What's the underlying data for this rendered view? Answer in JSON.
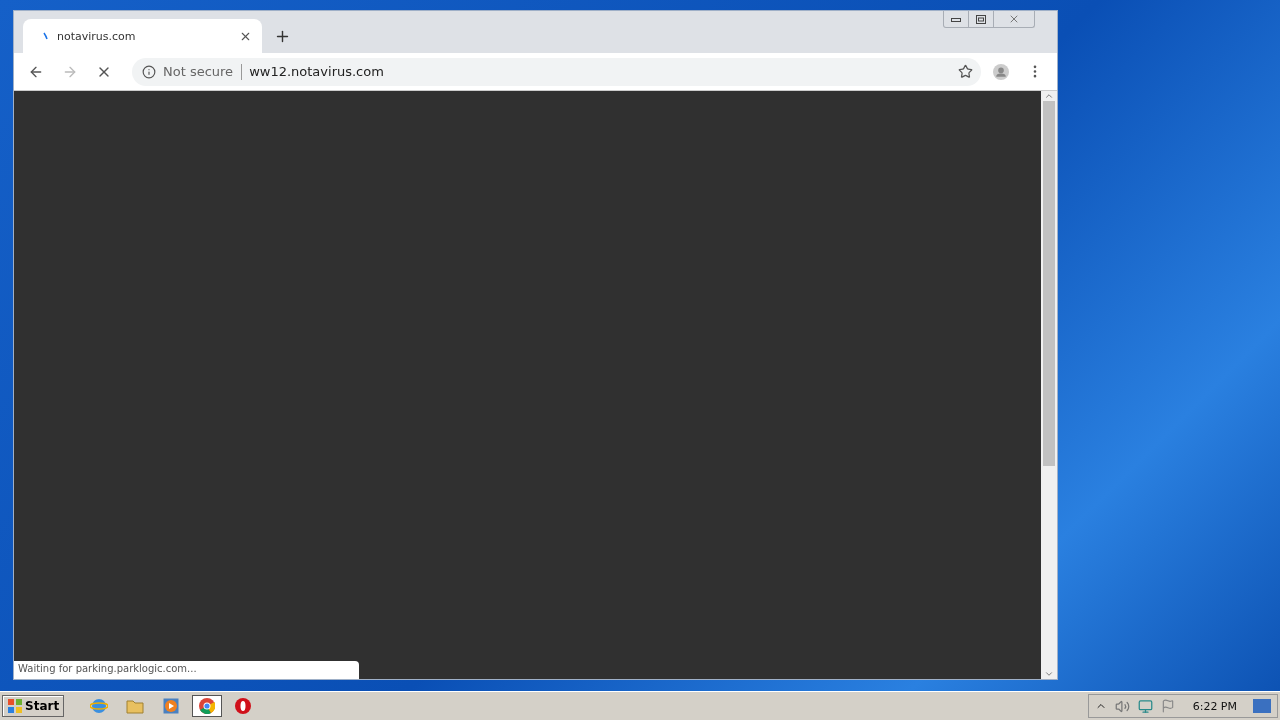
{
  "browser": {
    "tabs": [
      {
        "title": "notavirus.com",
        "selected": true,
        "loading": true
      }
    ],
    "nav_buttons": [
      {
        "kind": "back",
        "disabled": false
      },
      {
        "kind": "forward",
        "disabled": true
      },
      {
        "kind": "stop",
        "disabled": false
      }
    ],
    "address_bar": {
      "security": "Not secure",
      "url": "ww12.notavirus.com"
    },
    "status": "Waiting for parking.parklogic.com..."
  },
  "taskbar": {
    "start": "Start",
    "apps": [
      {
        "kind": "ie",
        "selected": false
      },
      {
        "kind": "folder",
        "selected": false
      },
      {
        "kind": "media",
        "selected": false
      },
      {
        "kind": "chrome",
        "selected": true
      },
      {
        "kind": "opera",
        "selected": false
      }
    ],
    "clock": "6:22 PM"
  }
}
